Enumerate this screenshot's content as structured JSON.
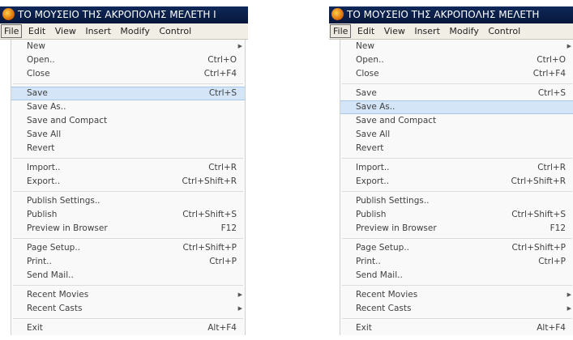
{
  "left": {
    "title": "ΤΟ ΜΟΥΣΕΙΟ ΤΗΣ ΑΚΡΟΠΟΛΗΣ ΜΕΛΕΤΗ Ι",
    "menus": [
      "File",
      "Edit",
      "View",
      "Insert",
      "Modify",
      "Control"
    ],
    "highlighted": "Save"
  },
  "right": {
    "title": "ΤΟ ΜΟΥΣΕΙΟ ΤΗΣ ΑΚΡΟΠΟΛΗΣ ΜΕΛΕΤΗ",
    "menus": [
      "File",
      "Edit",
      "View",
      "Insert",
      "Modify",
      "Control"
    ],
    "highlighted": "Save As.."
  },
  "file_menu": [
    {
      "label": "New",
      "shortcut": "",
      "submenu": true
    },
    {
      "label": "Open..",
      "shortcut": "Ctrl+O"
    },
    {
      "label": "Close",
      "shortcut": "Ctrl+F4"
    },
    {
      "separator": true
    },
    {
      "label": "Save",
      "shortcut": "Ctrl+S"
    },
    {
      "label": "Save As..",
      "shortcut": ""
    },
    {
      "label": "Save and Compact",
      "shortcut": ""
    },
    {
      "label": "Save All",
      "shortcut": ""
    },
    {
      "label": "Revert",
      "shortcut": ""
    },
    {
      "separator": true
    },
    {
      "label": "Import..",
      "shortcut": "Ctrl+R"
    },
    {
      "label": "Export..",
      "shortcut": "Ctrl+Shift+R"
    },
    {
      "separator": true
    },
    {
      "label": "Publish Settings..",
      "shortcut": ""
    },
    {
      "label": "Publish",
      "shortcut": "Ctrl+Shift+S"
    },
    {
      "label": "Preview in Browser",
      "shortcut": "F12"
    },
    {
      "separator": true
    },
    {
      "label": "Page Setup..",
      "shortcut": "Ctrl+Shift+P"
    },
    {
      "label": "Print..",
      "shortcut": "Ctrl+P"
    },
    {
      "label": "Send Mail..",
      "shortcut": ""
    },
    {
      "separator": true
    },
    {
      "label": "Recent Movies",
      "shortcut": "",
      "submenu": true
    },
    {
      "label": "Recent Casts",
      "shortcut": "",
      "submenu": true
    },
    {
      "separator": true
    },
    {
      "label": "Exit",
      "shortcut": "Alt+F4"
    }
  ],
  "icons": {
    "app": "director-app-icon",
    "submenu": "submenu-arrow-icon"
  },
  "colors": {
    "titlebar": "#0b2150",
    "highlight": "#d3e5f7",
    "menu_bg": "#f9f9f9"
  }
}
